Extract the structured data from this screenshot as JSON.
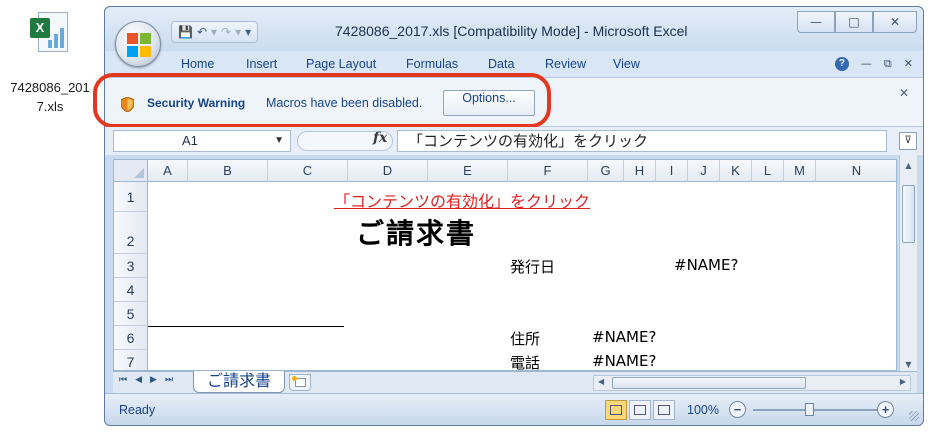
{
  "desktop": {
    "file_label": "7428086_2017.xls",
    "file_label_line1": "7428086_201",
    "file_label_line2": "7.xls"
  },
  "window": {
    "title": "7428086_2017.xls  [Compatibility Mode] - Microsoft Excel",
    "tabs": [
      "Home",
      "Insert",
      "Page Layout",
      "Formulas",
      "Data",
      "Review",
      "View"
    ]
  },
  "message_bar": {
    "label": "Security Warning",
    "message": "Macros have been disabled.",
    "button": "Options...",
    "highlight_color": "#e3381f"
  },
  "formula_bar": {
    "name_box": "A1",
    "fx": "fx",
    "content": "「コンテンツの有効化」をクリック"
  },
  "sheet": {
    "columns": [
      "A",
      "B",
      "C",
      "D",
      "E",
      "F",
      "G",
      "H",
      "I",
      "J",
      "K",
      "L",
      "M",
      "N"
    ],
    "rows": [
      "1",
      "2",
      "3",
      "4",
      "5",
      "6",
      "7"
    ],
    "notice": "「コンテンツの有効化」をクリック",
    "doc_title": "ご請求書",
    "issue_date_label": "発行日",
    "issue_date_value": "#NAME?",
    "address_label": "住所",
    "address_value": "#NAME?",
    "phone_label": "電話",
    "phone_value": "#NAME?",
    "notice_color": "#e02020"
  },
  "sheet_tabs": {
    "active": "ご請求書"
  },
  "status_bar": {
    "status": "Ready",
    "zoom": "100%"
  }
}
